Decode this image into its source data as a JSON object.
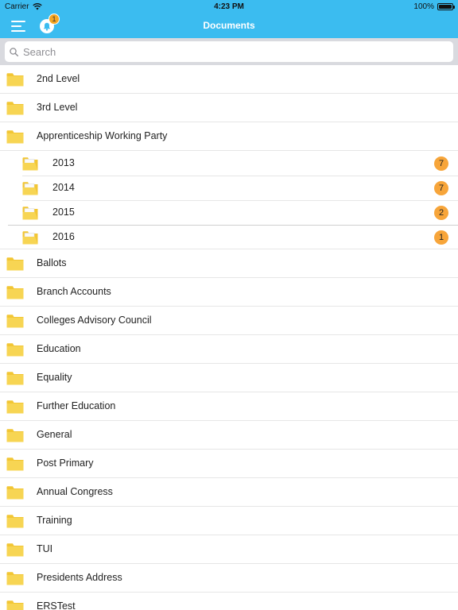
{
  "status_bar": {
    "carrier": "Carrier",
    "time": "4:23 PM",
    "battery": "100%"
  },
  "nav": {
    "title": "Documents",
    "notification_count": "1",
    "menu_icon": "hamburger-menu-icon",
    "bell_icon": "bell-icon"
  },
  "search": {
    "placeholder": "Search",
    "value": ""
  },
  "colors": {
    "accent": "#3bbcf0",
    "badge": "#f7a53a",
    "folder": "#f4c93a"
  },
  "folders": [
    {
      "label": "2nd Level",
      "level": 0
    },
    {
      "label": "3rd Level",
      "level": 0
    },
    {
      "label": "Apprenticeship Working Party",
      "level": 0
    },
    {
      "label": "2013",
      "level": 1,
      "count": "7"
    },
    {
      "label": "2014",
      "level": 1,
      "count": "7"
    },
    {
      "label": "2015",
      "level": 1,
      "count": "2"
    },
    {
      "label": "2016",
      "level": 1,
      "count": "1"
    },
    {
      "label": "Ballots",
      "level": 0
    },
    {
      "label": "Branch Accounts",
      "level": 0
    },
    {
      "label": "Colleges Advisory Council",
      "level": 0
    },
    {
      "label": "Education",
      "level": 0
    },
    {
      "label": "Equality",
      "level": 0
    },
    {
      "label": "Further Education",
      "level": 0
    },
    {
      "label": "General",
      "level": 0
    },
    {
      "label": "Post Primary",
      "level": 0
    },
    {
      "label": "Annual Congress",
      "level": 0
    },
    {
      "label": "Training",
      "level": 0
    },
    {
      "label": "TUI",
      "level": 0
    },
    {
      "label": "Presidents Address",
      "level": 0
    },
    {
      "label": "ERSTest",
      "level": 0
    }
  ]
}
